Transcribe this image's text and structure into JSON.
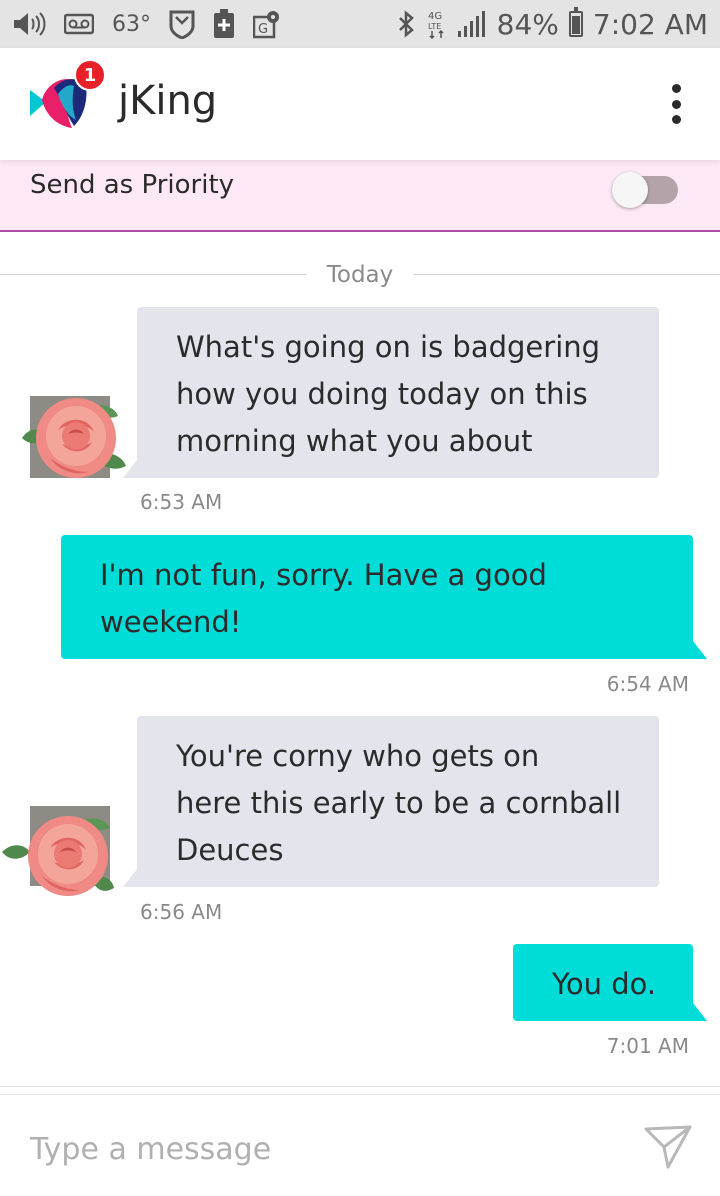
{
  "status_bar": {
    "temperature": "63°",
    "battery": "84%",
    "time": "7:02 AM",
    "battery_level": 0.84
  },
  "header": {
    "contact_name": "jKing",
    "notification_count": "1"
  },
  "priority": {
    "label": "Send as Priority",
    "enabled": false
  },
  "divider": {
    "label": "Today"
  },
  "messages": [
    {
      "direction": "incoming",
      "lines": [
        "What's going on is badgering",
        "how you doing today on this",
        "morning what you about"
      ],
      "time": "6:53 AM"
    },
    {
      "direction": "outgoing",
      "lines": [
        "I'm not fun, sorry. Have a good",
        "weekend!"
      ],
      "time": "6:54 AM"
    },
    {
      "direction": "incoming",
      "lines": [
        "You're corny who gets on",
        "here this early to be a cornball",
        "Deuces"
      ],
      "time": "6:56 AM"
    },
    {
      "direction": "outgoing",
      "lines": [
        "You do."
      ],
      "time": "7:01 AM"
    }
  ],
  "compose": {
    "placeholder": "Type a message"
  },
  "colors": {
    "incoming_bubble": "#e3e4ec",
    "outgoing_bubble": "#00dcd8",
    "priority_bg": "#fde8f5",
    "priority_border": "#b04aa6",
    "badge": "#e8202a"
  },
  "icons": [
    "volume-icon",
    "voicemail-icon",
    "shield-icon",
    "battery-plus-icon",
    "map-icon",
    "bluetooth-icon",
    "lte-icon",
    "signal-icon",
    "battery-icon",
    "app-logo-icon",
    "overflow-menu-icon",
    "send-icon",
    "contact-avatar"
  ]
}
